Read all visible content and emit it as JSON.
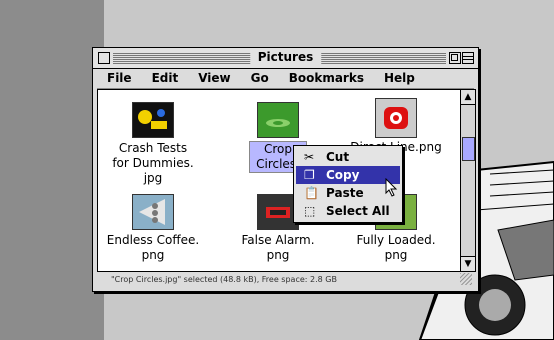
{
  "window": {
    "title": "Pictures"
  },
  "menu": [
    "File",
    "Edit",
    "View",
    "Go",
    "Bookmarks",
    "Help"
  ],
  "items": [
    {
      "name": "Crash Tests\nfor Dummies.\njpg",
      "icon": "crash-test-thumb"
    },
    {
      "name": "Crop\nCircles.",
      "icon": "crop-circles-thumb"
    },
    {
      "name": "Direct Line.png",
      "icon": "direct-line-thumb"
    },
    {
      "name": "Endless Coffee.\npng",
      "icon": "endless-coffee-thumb"
    },
    {
      "name": "False Alarm.\npng",
      "icon": "false-alarm-thumb"
    },
    {
      "name": "Fully Loaded.\npng",
      "icon": "fully-loaded-thumb"
    }
  ],
  "status": "\"Crop Circles.jpg\" selected (48.8 kB), Free space: 2.8 GB",
  "context_menu": [
    {
      "label": "Cut",
      "icon": "scissors-icon"
    },
    {
      "label": "Copy",
      "icon": "copy-icon"
    },
    {
      "label": "Paste",
      "icon": "paste-icon"
    },
    {
      "label": "Select All",
      "icon": "select-all-icon"
    }
  ]
}
